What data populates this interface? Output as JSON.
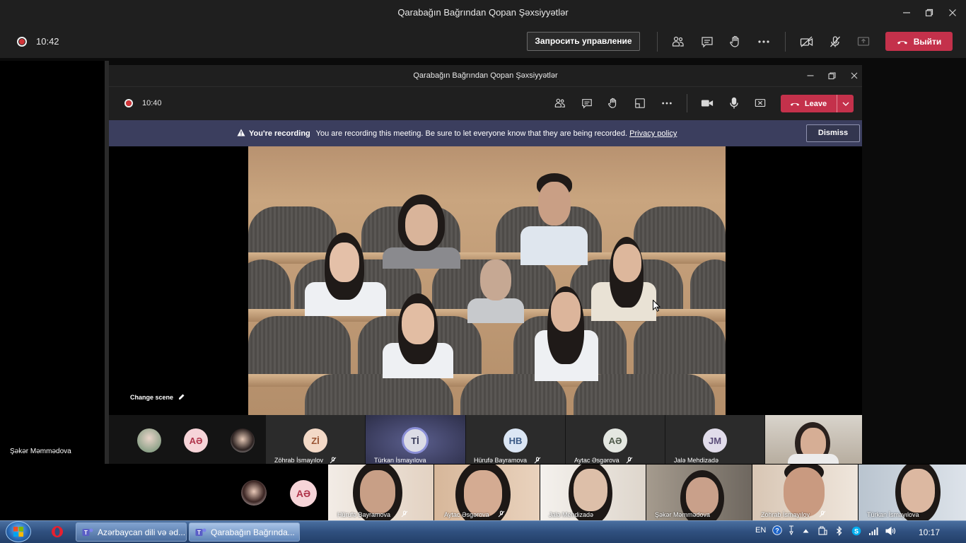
{
  "outer_window": {
    "title": "Qarabağın Bağrından Qopan Şəxsiyyətlər",
    "time": "10:42",
    "request_control_label": "Запросить управление",
    "leave_label": "Выйти",
    "stage_user": "Şəkər Məmmədova"
  },
  "inner_window": {
    "title": "Qarabağın Bağrından Qopan Şəxsiyyətlər",
    "time": "10:40",
    "leave_label": "Leave",
    "banner": {
      "heading": "You're recording",
      "message": "You are recording this meeting. Be sure to let everyone know that they are being recorded.",
      "link": "Privacy policy",
      "dismiss": "Dismiss"
    },
    "change_scene": "Change scene"
  },
  "inner_strip": [
    {
      "initials": "",
      "name": ""
    },
    {
      "initials": "AƏ",
      "name": ""
    },
    {
      "initials": "",
      "name": ""
    },
    {
      "initials": "Zİ",
      "name": "Zöhrab İsmayılov"
    },
    {
      "initials": "Tİ",
      "name": "Türkan İsmayılova"
    },
    {
      "initials": "HB",
      "name": "Hürufə Bayramova"
    },
    {
      "initials": "AƏ",
      "name": "Aytac Əsgərova"
    },
    {
      "initials": "JM",
      "name": "Jalə Mehdizadə"
    }
  ],
  "bottom_strip": {
    "avatar_initials": "AƏ",
    "video_tiles": [
      {
        "name": "Hürufə Bayramova"
      },
      {
        "name": "Aytac Əsgərova"
      },
      {
        "name": "Jalə Mehdizadə"
      },
      {
        "name": "Şəkər Məmmədova"
      },
      {
        "name": "Zöhrab İsmayılov"
      },
      {
        "name": "Türkan İsmayılova"
      }
    ]
  },
  "taskbar": {
    "tasks": [
      {
        "label": "Azərbaycan dili və əd..."
      },
      {
        "label": "Qarabağın Bağrında..."
      }
    ],
    "language": "EN",
    "clock": "10:17"
  },
  "colors": {
    "leave_red": "#c4314b",
    "banner_bg": "#3b3e5e",
    "toolbar_bg": "#1f1f1f",
    "recording_red": "#d13438"
  }
}
